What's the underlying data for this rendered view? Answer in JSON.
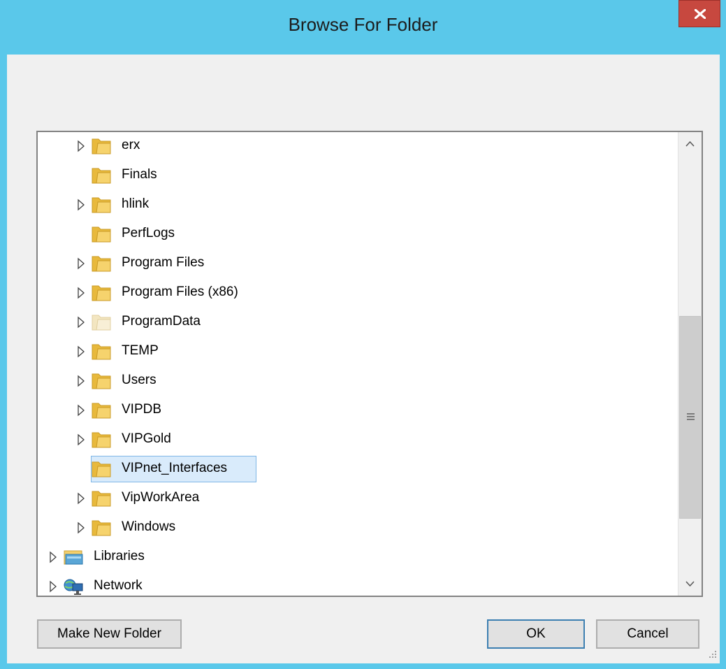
{
  "window": {
    "title": "Browse For Folder"
  },
  "tree": {
    "items": [
      {
        "label": "erx",
        "expandable": true,
        "icon": "folder-icon",
        "indent": 1
      },
      {
        "label": "Finals",
        "expandable": false,
        "icon": "folder-icon",
        "indent": 1
      },
      {
        "label": "hlink",
        "expandable": true,
        "icon": "folder-icon",
        "indent": 1
      },
      {
        "label": "PerfLogs",
        "expandable": false,
        "icon": "folder-icon",
        "indent": 1
      },
      {
        "label": "Program Files",
        "expandable": true,
        "icon": "folder-icon",
        "indent": 1
      },
      {
        "label": "Program Files (x86)",
        "expandable": true,
        "icon": "folder-icon",
        "indent": 1
      },
      {
        "label": "ProgramData",
        "expandable": true,
        "icon": "hidden-folder-icon",
        "indent": 1
      },
      {
        "label": "TEMP",
        "expandable": true,
        "icon": "folder-icon",
        "indent": 1
      },
      {
        "label": "Users",
        "expandable": true,
        "icon": "folder-icon",
        "indent": 1
      },
      {
        "label": "VIPDB",
        "expandable": true,
        "icon": "folder-icon",
        "indent": 1
      },
      {
        "label": "VIPGold",
        "expandable": true,
        "icon": "folder-icon",
        "indent": 1
      },
      {
        "label": "VIPnet_Interfaces",
        "expandable": false,
        "icon": "folder-icon",
        "indent": 1,
        "selected": true
      },
      {
        "label": "VipWorkArea",
        "expandable": true,
        "icon": "folder-icon",
        "indent": 1
      },
      {
        "label": "Windows",
        "expandable": true,
        "icon": "folder-icon",
        "indent": 1
      },
      {
        "label": "Libraries",
        "expandable": true,
        "icon": "libraries-icon",
        "indent": 0
      },
      {
        "label": "Network",
        "expandable": true,
        "icon": "network-icon",
        "indent": 0
      }
    ]
  },
  "buttons": {
    "make_new_folder": "Make New Folder",
    "ok": "OK",
    "cancel": "Cancel"
  },
  "colors": {
    "title_bar": "#5ac8ea",
    "close_button": "#c7483f",
    "selection_fill": "#d9ebfb",
    "selection_border": "#7fb6e6",
    "folder": "#e8b93c"
  }
}
